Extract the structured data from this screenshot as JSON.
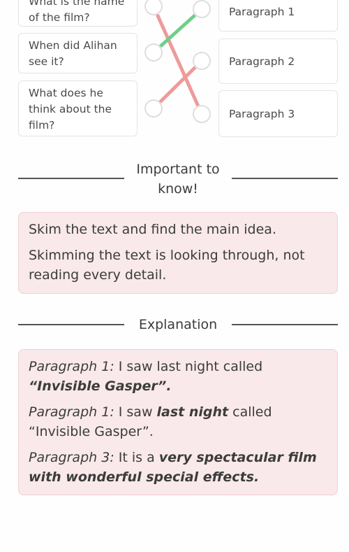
{
  "matching": {
    "questions": [
      {
        "label": "What is the name of the film?"
      },
      {
        "label": "When did Alihan see it?"
      },
      {
        "label": "What does he think about the film?"
      }
    ],
    "answers": [
      {
        "label": "Paragraph 1"
      },
      {
        "label": "Paragraph 2"
      },
      {
        "label": "Paragraph 3"
      }
    ],
    "connections": [
      {
        "from_question": 1,
        "to_answer": 3,
        "status": "incorrect",
        "color": "#ef9a9a"
      },
      {
        "from_question": 2,
        "to_answer": 1,
        "status": "correct",
        "color": "#6fcf8a"
      },
      {
        "from_question": 3,
        "to_answer": 2,
        "status": "incorrect",
        "color": "#ef9a9a"
      }
    ]
  },
  "important": {
    "heading": "Important to know!",
    "lines": [
      "Skim the text and find the main idea.",
      "Skimming the text is looking through, not reading every detail."
    ]
  },
  "explanation": {
    "heading": "Explanation",
    "items": [
      {
        "prefix": "Paragraph",
        "num": " 1:",
        "plain1": " I saw last night called ",
        "bold": "“Invisible Gasper”.",
        "plain2": ""
      },
      {
        "prefix": "Paragraph",
        "num": " 1:",
        "plain1": " I saw ",
        "bold": "last night",
        "plain2": " called “Invisible Gasper”."
      },
      {
        "prefix": "Paragraph",
        "num": " 3:",
        "plain1": " It is a ",
        "bold": "very spectacular film with wonderful special effects.",
        "plain2": ""
      }
    ]
  }
}
